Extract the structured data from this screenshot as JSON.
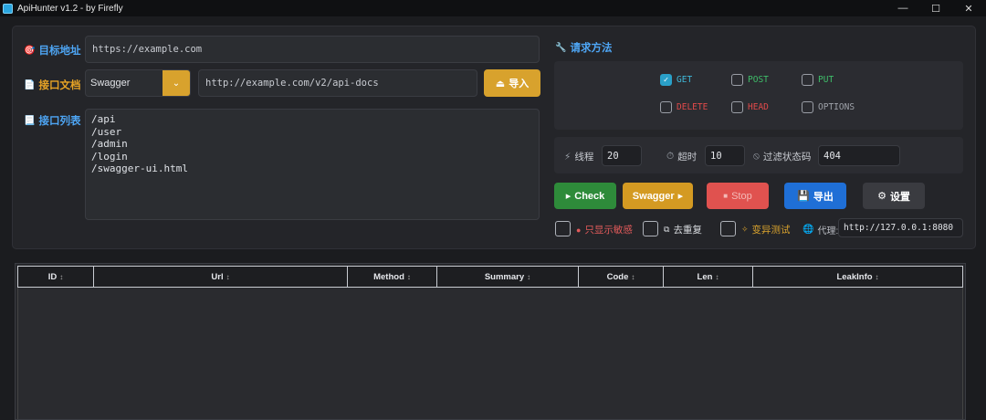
{
  "window": {
    "title": "ApiHunter v1.2 - by Firefly",
    "controls": [
      "—",
      "☐",
      "✕"
    ]
  },
  "target": {
    "label": "目标地址",
    "value": "https://example.com"
  },
  "doc": {
    "label": "接口文档",
    "type_selected": "Swagger",
    "url": "http://example.com/v2/api-docs",
    "import_label": "导入"
  },
  "list": {
    "label": "接口列表",
    "paths": [
      "/api",
      "/user",
      "/admin",
      "/login",
      "/swagger-ui.html"
    ]
  },
  "methods": {
    "label": "请求方法",
    "items": [
      {
        "name": "GET",
        "checked": true,
        "color": "#3fb8d8"
      },
      {
        "name": "POST",
        "checked": false,
        "color": "#3fbf6a"
      },
      {
        "name": "PUT",
        "checked": false,
        "color": "#3fbf6a"
      },
      {
        "name": "DELETE",
        "checked": false,
        "color": "#e04a4a"
      },
      {
        "name": "HEAD",
        "checked": false,
        "color": "#e04a4a"
      },
      {
        "name": "OPTIONS",
        "checked": false,
        "color": "#9ea2a9"
      }
    ]
  },
  "params": {
    "threads_label": "线程",
    "threads": "20",
    "timeout_label": "超时",
    "timeout": "10",
    "filter_label": "过滤状态码",
    "filter": "404"
  },
  "actions": {
    "check": "Check",
    "swagger": "Swagger",
    "stop": "Stop",
    "export": "导出",
    "settings": "设置"
  },
  "options": {
    "sensitive": "只显示敏感",
    "dedupe": "去重复",
    "mutate": "变异测试",
    "proxy_label": "代理:",
    "proxy": "http://127.0.0.1:8080"
  },
  "table": {
    "columns": [
      "ID",
      "Url",
      "Method",
      "Summary",
      "Code",
      "Len",
      "LeakInfo"
    ],
    "rows": []
  },
  "colors": {
    "accent_blue": "#4ea6f5",
    "accent_orange": "#e8a425",
    "check_green": "#2e8b3a",
    "swagger_gold": "#d49a22",
    "stop_red": "#e0524f",
    "export_blue": "#1f6fd6",
    "settings_gray": "#3a3b40"
  }
}
